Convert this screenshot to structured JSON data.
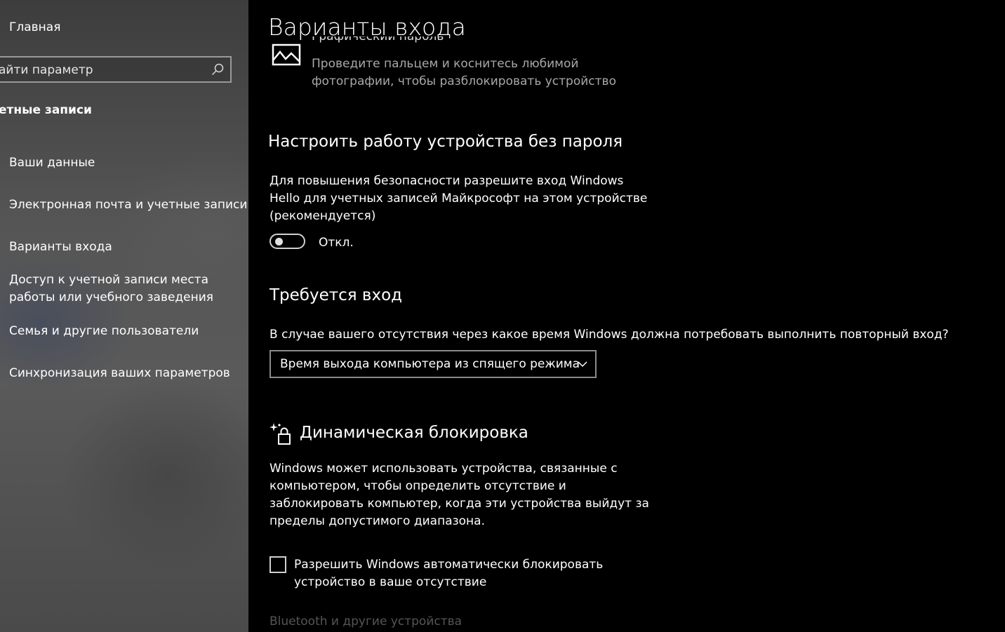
{
  "sidebar": {
    "home_label": "Главная",
    "search_placeholder": "айти параметр",
    "section_title": "етные записи",
    "items": [
      {
        "label": "Ваши данные"
      },
      {
        "label": "Электронная почта и учетные записи"
      },
      {
        "label": "Варианты входа"
      },
      {
        "label": "Доступ к учетной записи места работы или учебного заведения"
      },
      {
        "label": "Семья и другие пользователи"
      },
      {
        "label": "Синхронизация ваших параметров"
      }
    ]
  },
  "main": {
    "title": "Варианты входа",
    "picture_password": {
      "title_clipped": "Графический пароль",
      "description": "Проведите пальцем и коснитесь любимой фотографии, чтобы разблокировать устройство"
    },
    "passwordless": {
      "heading": "Настроить работу устройства без пароля",
      "description": "Для повышения безопасности разрешите вход Windows Hello для учетных записей Майкрософт на этом устройстве (рекомендуется)",
      "toggle_state": "Откл."
    },
    "require_signin": {
      "heading": "Требуется вход",
      "question": "В случае вашего отсутствия через какое время Windows должна потребовать выполнить повторный вход?",
      "dropdown_value": "Время выхода компьютера из спящего режима"
    },
    "dynamic_lock": {
      "heading": "Динамическая блокировка",
      "description": "Windows может использовать устройства, связанные с компьютером, чтобы определить отсутствие и заблокировать компьютер, когда эти устройства выйдут за пределы допустимого диапазона.",
      "checkbox_label": "Разрешить Windows автоматически блокировать устройство в ваше отсутствие",
      "checkbox_checked": false
    },
    "bluetooth_link": "Bluetooth и другие устройства"
  }
}
